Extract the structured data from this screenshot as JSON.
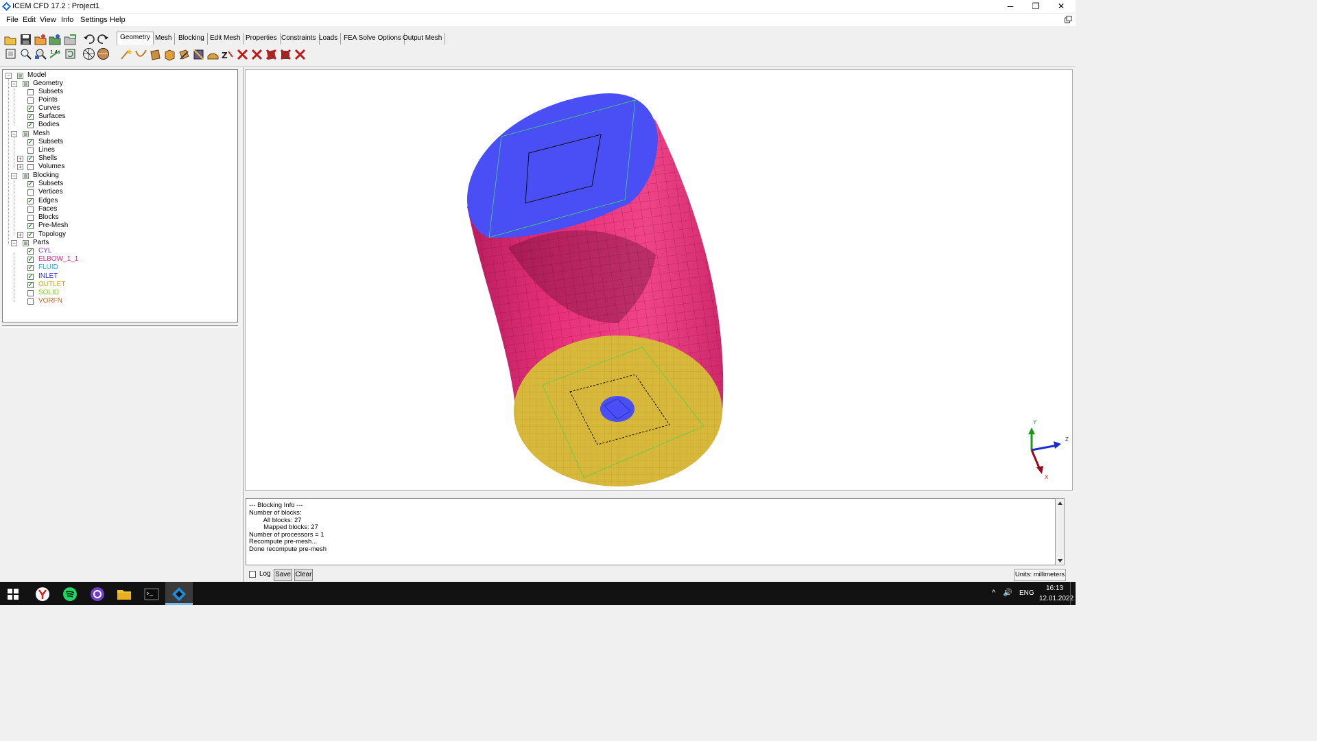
{
  "window": {
    "title": "ICEM CFD 17.2 : Project1",
    "controls": {
      "minimize": "─",
      "restore": "❐",
      "close": "✕"
    }
  },
  "menu": [
    "File",
    "Edit",
    "View",
    "Info",
    "Settings",
    "Help"
  ],
  "tabs": [
    "Geometry",
    "Mesh",
    "Blocking",
    "Edit Mesh",
    "Properties",
    "Constraints",
    "Loads",
    "FEA Solve Options",
    "Output Mesh"
  ],
  "active_tab": "Geometry",
  "tree": {
    "model": "Model",
    "geometry": {
      "label": "Geometry",
      "items": [
        "Subsets",
        "Points",
        "Curves",
        "Surfaces",
        "Bodies"
      ]
    },
    "mesh": {
      "label": "Mesh",
      "items": [
        "Subsets",
        "Lines",
        "Shells",
        "Volumes"
      ]
    },
    "blocking": {
      "label": "Blocking",
      "items": [
        "Subsets",
        "Vertices",
        "Edges",
        "Faces",
        "Blocks",
        "Pre-Mesh",
        "Topology"
      ]
    },
    "parts": {
      "label": "Parts",
      "items": [
        "CYL",
        "ELBOW_1_1",
        "FLUID",
        "INLET",
        "OUTLET",
        "SOLID",
        "VORFN"
      ]
    }
  },
  "colors": {
    "CYL": "#8a2be2",
    "ELBOW_1_1": "#e0207a",
    "FLUID": "#20a8e8",
    "INLET": "#3030e0",
    "OUTLET": "#c8a800",
    "SOLID": "#7ad000",
    "VORFN": "#e06020",
    "elbow_surface": "#e8307a",
    "inlet_face": "#4a4ef5",
    "outlet_face": "#d8b83a"
  },
  "messages": [
    "--- Blocking Info ---",
    "Number of blocks:",
    "        All blocks: 27",
    "        Mapped blocks: 27",
    "Number of processors = 1",
    "Recompute pre-mesh...",
    "Done recompute pre-mesh"
  ],
  "bottom": {
    "log": "Log",
    "save": "Save",
    "clear": "Clear",
    "units": "Units: millimeters"
  },
  "axes": {
    "x": "X",
    "y": "Y",
    "z": "Z"
  },
  "taskbar": {
    "tray_up": "^",
    "volume": "🔊",
    "lang": "ENG",
    "time": "16:13",
    "date": "12.01.2022"
  }
}
